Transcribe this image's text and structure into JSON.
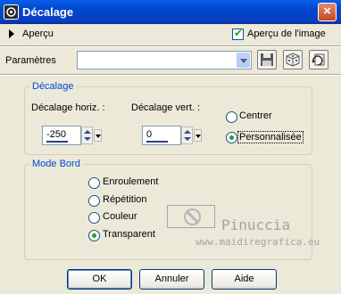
{
  "window": {
    "title": "Décalage",
    "close_glyph": "×"
  },
  "preview": {
    "label": "Aperçu",
    "image_preview_label": "Aperçu de l'image",
    "image_preview_checked": true
  },
  "params": {
    "label": "Paramètres",
    "preset_value": ""
  },
  "offset_group": {
    "legend": "Décalage",
    "horiz_label": "Décalage horiz. :",
    "horiz_value": "-250",
    "vert_label": "Décalage vert. :",
    "vert_value": "0",
    "options": [
      {
        "label": "Centrer",
        "selected": false
      },
      {
        "label": "Personnalisée",
        "selected": true
      }
    ]
  },
  "edge_group": {
    "legend": "Mode Bord",
    "options": [
      {
        "label": "Enroulement",
        "selected": false
      },
      {
        "label": "Répétition",
        "selected": false
      },
      {
        "label": "Couleur",
        "selected": false
      },
      {
        "label": "Transparent",
        "selected": true
      }
    ]
  },
  "watermark": {
    "line1": "Pinuccia",
    "line2": "www.maidiregrafica.eu"
  },
  "buttons": {
    "ok": "OK",
    "cancel": "Annuler",
    "help": "Aide"
  },
  "colors": {
    "title_bar": "#0047cf",
    "dialog_bg": "#ece9d8",
    "group_legend": "#0046d5",
    "radio_selected": "#21a121"
  }
}
